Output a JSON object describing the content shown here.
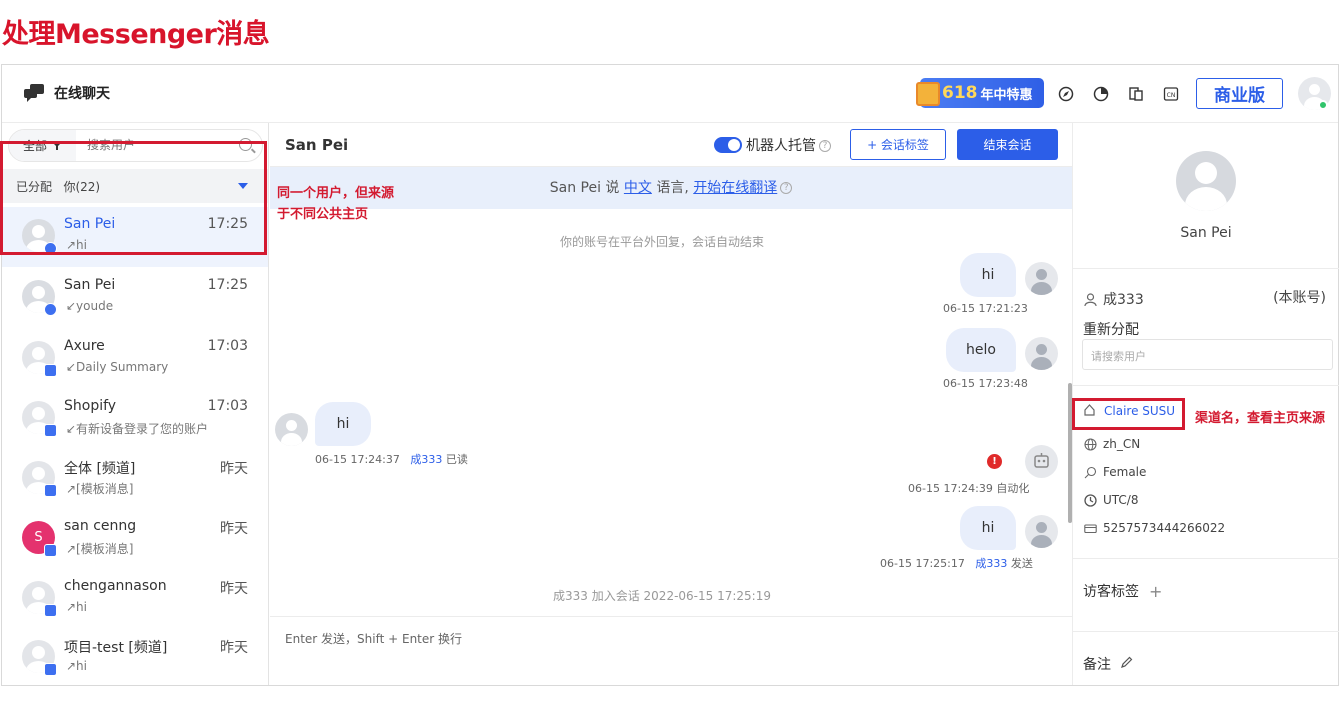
{
  "page_title": "处理Messenger消息",
  "topbar": {
    "brand": "在线聊天",
    "promo_number": "618",
    "promo_text": "年中特惠",
    "biz_label": "商业版"
  },
  "left": {
    "filter_label": "全部",
    "search_placeholder": "搜索用户",
    "assigned_label": "已分配",
    "assigned_count": "你(22)",
    "conversations": [
      {
        "name": "San Pei",
        "time": "17:25",
        "sub": "↗hi"
      },
      {
        "name": "San Pei",
        "time": "17:25",
        "sub": "↙youde"
      },
      {
        "name": "Axure",
        "time": "17:03",
        "sub": "↙Daily Summary"
      },
      {
        "name": "Shopify",
        "time": "17:03",
        "sub": "↙有新设备登录了您的账户"
      },
      {
        "name": "全体 [频道]",
        "time": "昨天",
        "sub": "↗[模板消息]"
      },
      {
        "name": "san cenng",
        "time": "昨天",
        "sub": "↗[模板消息]",
        "initial": "S"
      },
      {
        "name": "chengannason",
        "time": "昨天",
        "sub": "↗hi"
      },
      {
        "name": "项目-test [频道]",
        "time": "昨天",
        "sub": "↗hi"
      }
    ],
    "annotation": "同一个用户，但来源于不同公共主页"
  },
  "chat": {
    "name": "San Pei",
    "bot_label": "机器人托管",
    "tag_button": "+ 会话标签",
    "end_button": "结束会话",
    "translate": {
      "prefix": "San Pei 说 ",
      "lang": "中文",
      "mid": " 语言, ",
      "link": "开始在线翻译"
    },
    "sys_closed": "你的账号在平台外回复，会话自动结束",
    "messages": [
      {
        "text": "hi",
        "meta": "06-15 17:21:23"
      },
      {
        "text": "helo",
        "meta": "06-15 17:23:48"
      },
      {
        "text": "hi",
        "meta_time": "06-15 17:24:37",
        "meta_user": "成333",
        "meta_status": "已读"
      },
      {
        "meta": "06-15 17:24:39 自动化"
      },
      {
        "text": "hi",
        "meta_time": "06-15 17:25:17",
        "meta_user": "成333",
        "meta_status": "发送"
      }
    ],
    "sys_joined": "成333 加入会话 2022-06-15 17:25:19",
    "composer_hint": "Enter 发送，Shift + Enter 换行"
  },
  "right": {
    "name": "San Pei",
    "agent": "成333",
    "account_label": "(本账号)",
    "reassign_label": "重新分配",
    "reassign_placeholder": "请搜索用户",
    "channel": "Claire SUSU",
    "locale": "zh_CN",
    "gender": "Female",
    "timezone": "UTC/8",
    "id": "5257573444266022",
    "tags_label": "访客标签",
    "notes_label": "备注",
    "annotation": "渠道名，查看主页来源"
  },
  "colors": {
    "accent": "#2c5ee8",
    "annotation_red": "#d31a30",
    "title_red": "#d8142b"
  }
}
